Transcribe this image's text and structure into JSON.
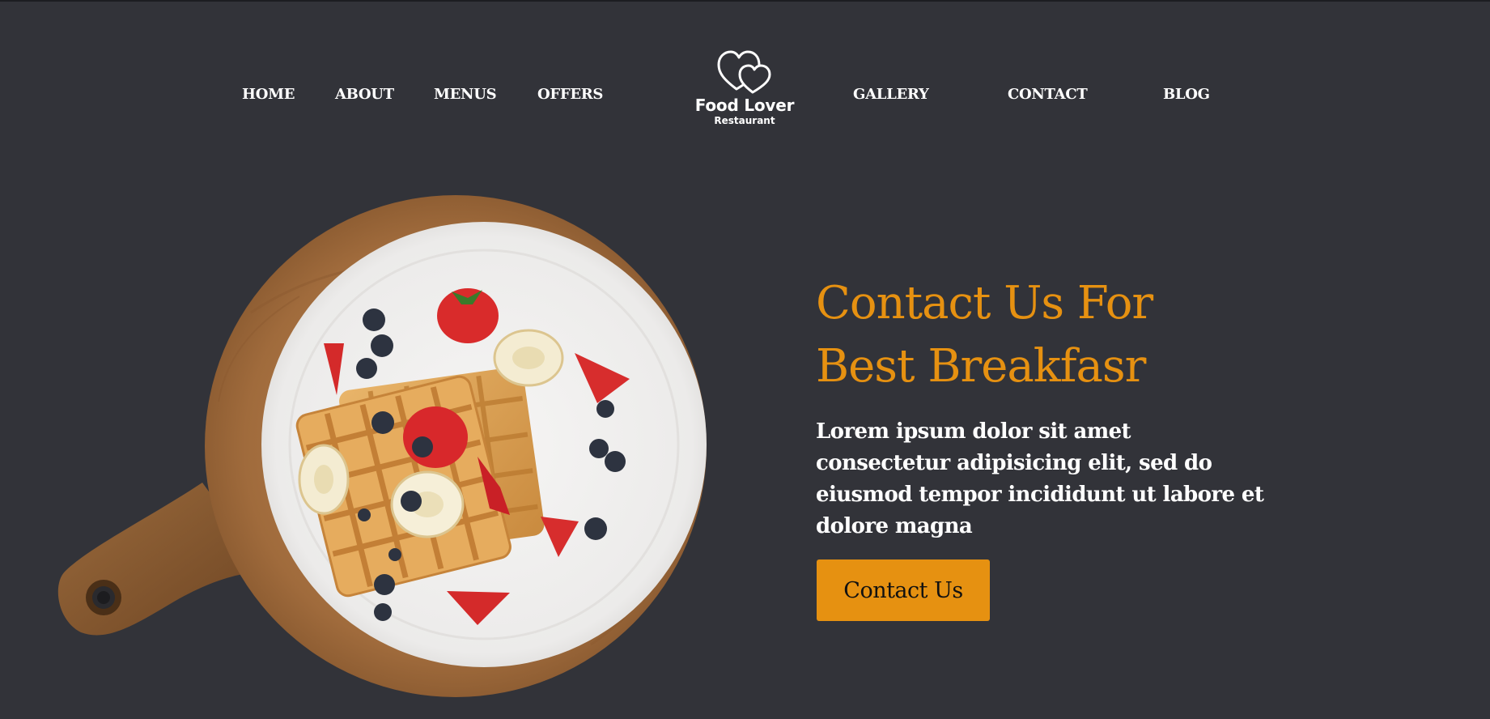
{
  "nav": {
    "left": [
      "HOME",
      "ABOUT",
      "MENUS",
      "OFFERS"
    ],
    "right": [
      "GALLERY",
      "CONTACT",
      "BLOG"
    ]
  },
  "logo": {
    "title": "Food Lover",
    "subtitle": "Restaurant",
    "icon": "double-heart-icon"
  },
  "hero": {
    "title_line1": "Contact Us For",
    "title_line2": "Best Breakfasr",
    "text": "Lorem ipsum dolor sit amet consectetur adipisicing elit, sed do eiusmod tempor incididunt ut labore et dolore magna",
    "button_label": "Contact Us"
  },
  "colors": {
    "background": "#323339",
    "accent": "#e69111",
    "text": "#ffffff"
  }
}
